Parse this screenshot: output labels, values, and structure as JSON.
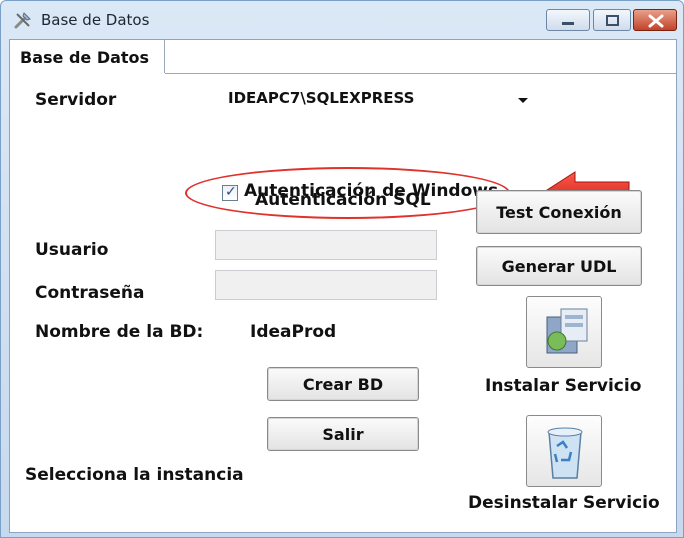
{
  "window": {
    "title": "Base de Datos",
    "accent": "#c7d9ee"
  },
  "tab": {
    "label": "Base de Datos"
  },
  "form": {
    "server_label": "Servidor",
    "server_value": "IDEAPC7\\SQLEXPRESS",
    "windows_auth_label": "Autenticación de Windows",
    "windows_auth_checked": true,
    "sql_auth_heading": "Autenticación SQL",
    "user_label": "Usuario",
    "user_value": "",
    "password_label": "Contraseña",
    "password_value": "",
    "db_name_label": "Nombre de la BD:",
    "db_name_value": "IdeaProd",
    "instance_label": "Selecciona la instancia"
  },
  "buttons": {
    "test_connection": "Test Conexión",
    "generate_udl": "Generar UDL",
    "create_db": "Crear BD",
    "exit": "Salir",
    "install_service": "Instalar Servicio",
    "uninstall_service": "Desinstalar Servicio"
  },
  "annotation_color": "#e0312b"
}
